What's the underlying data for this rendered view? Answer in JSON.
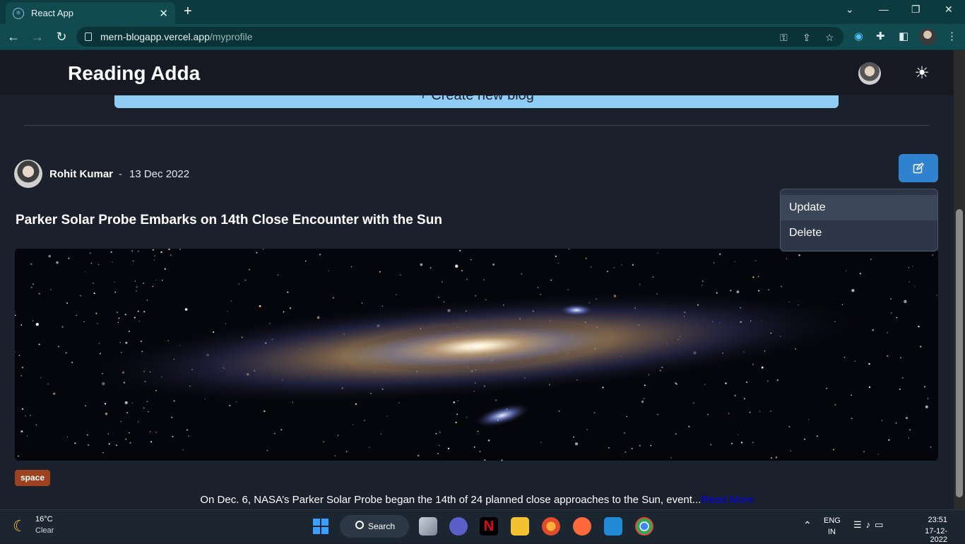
{
  "browser": {
    "tab_title": "React App",
    "new_tab_symbol": "+",
    "url_host": "mern-blogapp.vercel.app",
    "url_path": "/myprofile"
  },
  "app": {
    "brand": "Reading Adda",
    "create_label": "+ Create new blog"
  },
  "post": {
    "author": "Rohit Kumar",
    "separator": "-",
    "date": "13 Dec 2022",
    "title": "Parker Solar Probe Embarks on 14th Close Encounter with the Sun",
    "tag": "space",
    "excerpt": "On Dec. 6, NASA’s Parker Solar Probe began the 14th of 24 planned close approaches to the Sun, event...",
    "read_more": "Read More"
  },
  "menu": {
    "items": [
      "Update",
      "Delete"
    ]
  },
  "taskbar": {
    "temperature": "16°C",
    "condition": "Clear",
    "search_label": "Search",
    "lang_top": "ENG",
    "lang_bottom": "IN",
    "time": "23:51",
    "date": "17-12-2022"
  },
  "colors": {
    "browser_frame": "#0b3b3f",
    "page_bg": "#1a202c",
    "header_bg": "#171923",
    "create_button": "#90cdf4",
    "edit_button": "#3182ce",
    "tag_bg": "#9c4221",
    "link": "#0000ee"
  }
}
